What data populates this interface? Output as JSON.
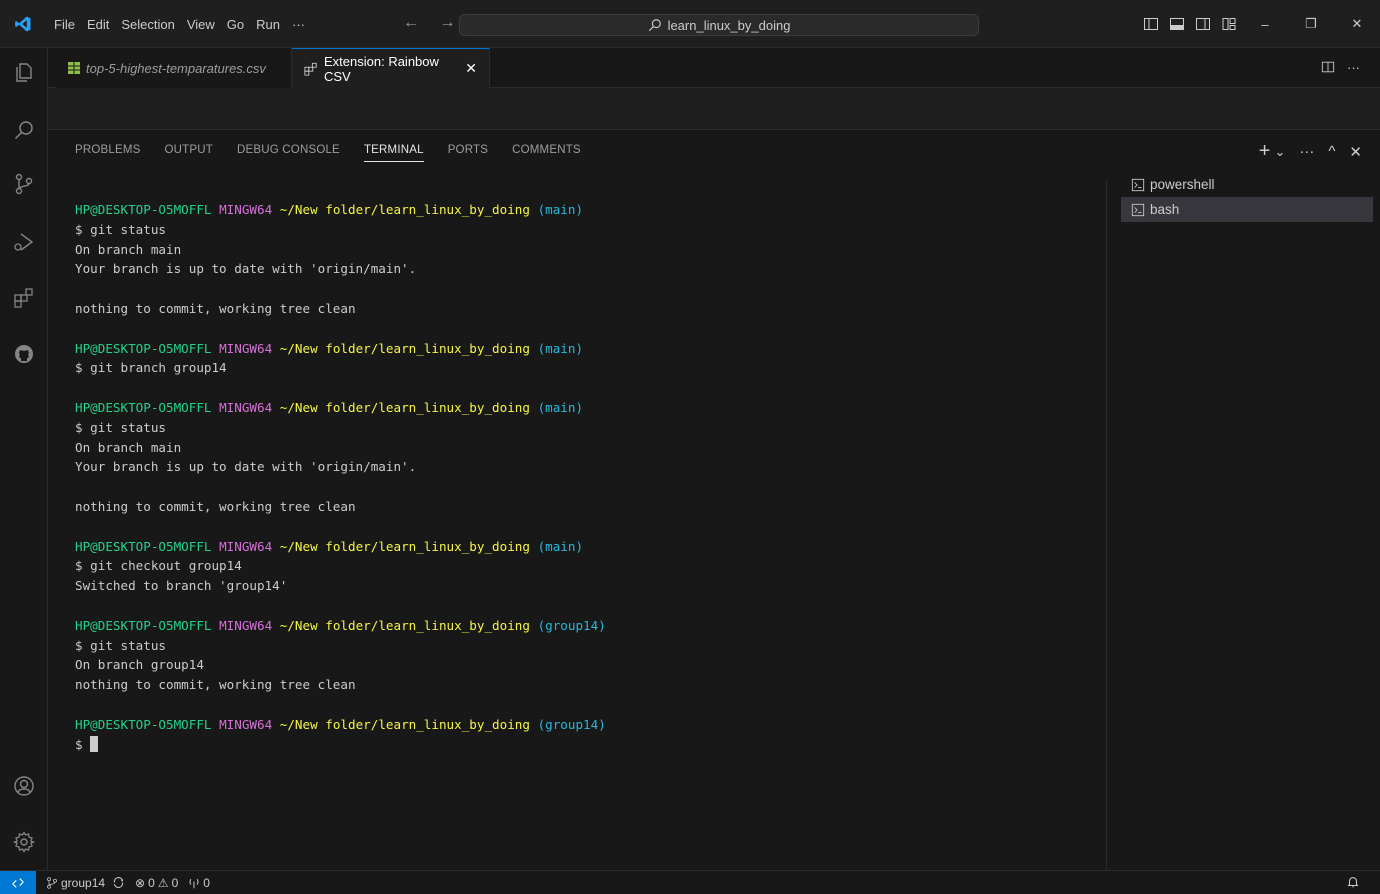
{
  "titlebar": {
    "menu": [
      "File",
      "Edit",
      "Selection",
      "View",
      "Go",
      "Run",
      "···"
    ],
    "nav_arrows": "← →",
    "search_text": "learn_linux_by_doing",
    "win_min": "–",
    "win_restore": "❐",
    "win_close": "✕"
  },
  "tabs": [
    {
      "label": "top-5-highest-temparatures.csv",
      "active": false
    },
    {
      "label": "Extension: Rainbow CSV",
      "active": true,
      "close": "✕"
    }
  ],
  "tab_actions": {
    "more": "···"
  },
  "panel": {
    "tabs": [
      "PROBLEMS",
      "OUTPUT",
      "DEBUG CONSOLE",
      "TERMINAL",
      "PORTS",
      "COMMENTS"
    ],
    "active_tab": "TERMINAL",
    "actions": {
      "add": "+",
      "dropdown": "⌄",
      "more": "···",
      "maximize": "^",
      "close": "✕"
    }
  },
  "terminal": {
    "prompt_user": "HP@DESKTOP-O5MOFFL",
    "prompt_host": "MINGW64",
    "prompt_path": "~/New folder/learn_linux_by_doing",
    "lines": [
      {
        "type": "prompt",
        "branch": "(main)"
      },
      {
        "type": "text",
        "text": "$ git status"
      },
      {
        "type": "text",
        "text": "On branch main"
      },
      {
        "type": "text",
        "text": "Your branch is up to date with 'origin/main'."
      },
      {
        "type": "text",
        "text": ""
      },
      {
        "type": "text",
        "text": "nothing to commit, working tree clean"
      },
      {
        "type": "text",
        "text": ""
      },
      {
        "type": "prompt",
        "branch": "(main)"
      },
      {
        "type": "text",
        "text": "$ git branch group14"
      },
      {
        "type": "text",
        "text": ""
      },
      {
        "type": "prompt",
        "branch": "(main)"
      },
      {
        "type": "text",
        "text": "$ git status"
      },
      {
        "type": "text",
        "text": "On branch main"
      },
      {
        "type": "text",
        "text": "Your branch is up to date with 'origin/main'."
      },
      {
        "type": "text",
        "text": ""
      },
      {
        "type": "text",
        "text": "nothing to commit, working tree clean"
      },
      {
        "type": "text",
        "text": ""
      },
      {
        "type": "prompt",
        "branch": "(main)"
      },
      {
        "type": "text",
        "text": "$ git checkout group14"
      },
      {
        "type": "text",
        "text": "Switched to branch 'group14'"
      },
      {
        "type": "text",
        "text": ""
      },
      {
        "type": "prompt",
        "branch": "(group14)"
      },
      {
        "type": "text",
        "text": "$ git status"
      },
      {
        "type": "text",
        "text": "On branch group14"
      },
      {
        "type": "text",
        "text": "nothing to commit, working tree clean"
      },
      {
        "type": "text",
        "text": ""
      },
      {
        "type": "prompt",
        "branch": "(group14)"
      },
      {
        "type": "input",
        "text": "$ "
      }
    ],
    "sessions": [
      {
        "label": "powershell",
        "active": false
      },
      {
        "label": "bash",
        "active": true
      }
    ]
  },
  "statusbar": {
    "branch": "group14",
    "errors": "0",
    "warnings": "0",
    "ports": "0"
  },
  "colors": {
    "accent": "#0078d4",
    "user": "#23d18b",
    "host": "#d670d6",
    "path": "#f5f543",
    "branch": "#29b8db"
  }
}
